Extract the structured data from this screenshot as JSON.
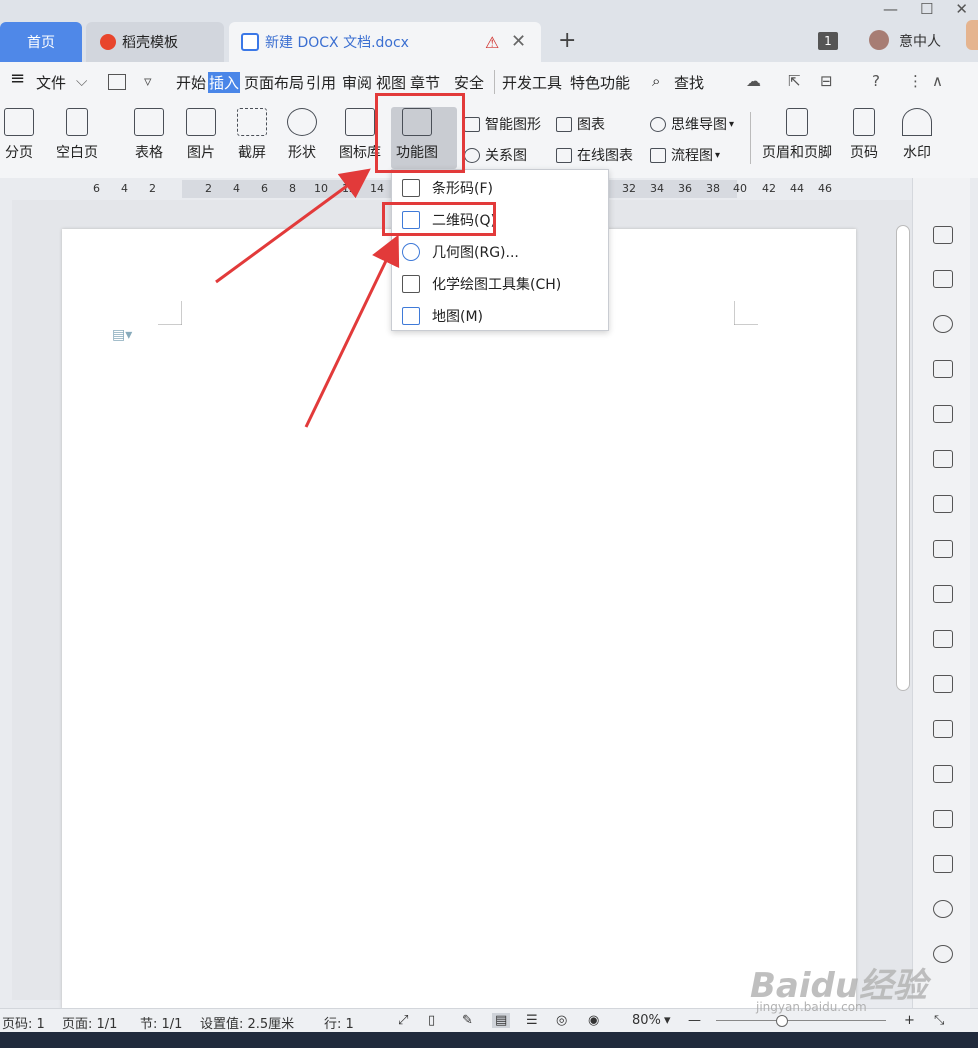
{
  "tabs": {
    "home": "首页",
    "template": "稻壳模板",
    "document": "新建 DOCX 文档.docx"
  },
  "window": {
    "badge": "1",
    "user": "意中人"
  },
  "menu": {
    "hamburger": "≡",
    "file": "文件",
    "items": [
      "开始",
      "插入",
      "页面布局",
      "引用",
      "审阅",
      "视图",
      "章节",
      "安全",
      "开发工具",
      "特色功能"
    ],
    "search": "查找"
  },
  "ribbon": {
    "page_break": "分页",
    "blank_page": "空白页",
    "table": "表格",
    "picture": "图片",
    "screenshot": "截屏",
    "shape": "形状",
    "icon_lib": "图标库",
    "func_chart": "功能图",
    "smart_shape": "智能图形",
    "relation": "关系图",
    "chart": "图表",
    "online_chart": "在线图表",
    "mindmap": "思维导图",
    "flowchart": "流程图",
    "header_footer": "页眉和页脚",
    "page_number": "页码",
    "watermark": "水印"
  },
  "dropdown": {
    "items": [
      "条形码(F)",
      "二维码(Q)",
      "几何图(RG)...",
      "化学绘图工具集(CH)",
      "地图(M)"
    ]
  },
  "ruler": {
    "ticks": [
      "6",
      "4",
      "2",
      "2",
      "4",
      "6",
      "8",
      "10",
      "12",
      "14",
      "32",
      "34",
      "36",
      "38",
      "40",
      "42",
      "44",
      "46"
    ]
  },
  "status": {
    "page_code": "页码: 1",
    "pages": "页面: 1/1",
    "section": "节: 1/1",
    "setting": "设置值: 2.5厘米",
    "row": "行: 1",
    "zoom": "80%"
  },
  "watermark": {
    "brand": "Baidu经验",
    "url": "jingyan.baidu.com"
  }
}
